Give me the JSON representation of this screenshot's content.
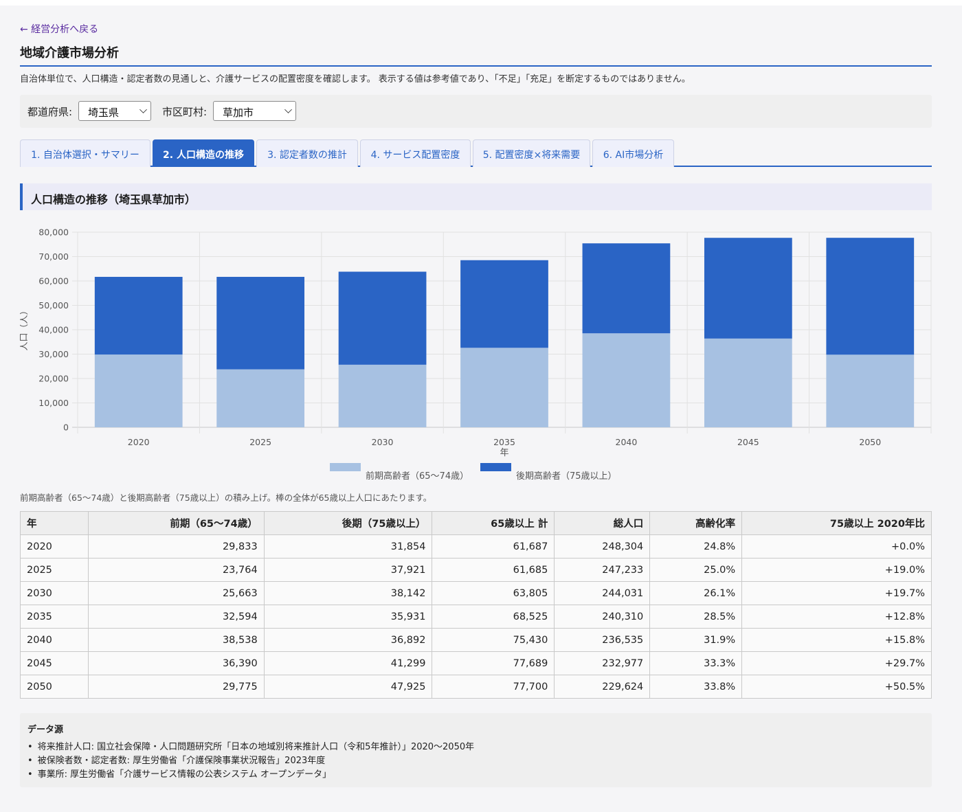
{
  "back_link": "← 経営分析へ戻る",
  "page_title": "地域介護市場分析",
  "description": "自治体単位で、人口構造・認定者数の見通しと、介護サービスの配置密度を確認します。 表示する値は参考値であり、「不足」「充足」を断定するものではありません。",
  "filters": {
    "prefecture_label": "都道府県:",
    "prefecture_value": "埼玉県",
    "city_label": "市区町村:",
    "city_value": "草加市"
  },
  "tabs": [
    {
      "label": "1. 自治体選択・サマリー",
      "active": false
    },
    {
      "label": "2. 人口構造の推移",
      "active": true
    },
    {
      "label": "3. 認定者数の推計",
      "active": false
    },
    {
      "label": "4. サービス配置密度",
      "active": false
    },
    {
      "label": "5. 配置密度×将来需要",
      "active": false
    },
    {
      "label": "6. AI市場分析",
      "active": false
    }
  ],
  "section_title": "人口構造の推移（埼玉県草加市）",
  "chart_data": {
    "type": "bar",
    "stacked": true,
    "categories": [
      "2020",
      "2025",
      "2030",
      "2035",
      "2040",
      "2045",
      "2050"
    ],
    "series": [
      {
        "name": "前期高齢者（65〜74歳）",
        "color": "#a7c1e2",
        "values": [
          29833,
          23764,
          25663,
          32594,
          38538,
          36390,
          29775
        ]
      },
      {
        "name": "後期高齢者（75歳以上）",
        "color": "#2a64c5",
        "values": [
          31854,
          37921,
          38142,
          35931,
          36892,
          41299,
          47925
        ]
      }
    ],
    "xlabel": "年",
    "ylabel": "人口（人）",
    "ylim": [
      0,
      80000
    ],
    "yticks": [
      "0",
      "10,000",
      "20,000",
      "30,000",
      "40,000",
      "50,000",
      "60,000",
      "70,000",
      "80,000"
    ],
    "grid": true,
    "legend_position": "bottom"
  },
  "chart_note": "前期高齢者（65〜74歳）と後期高齢者（75歳以上）の積み上げ。棒の全体が65歳以上人口にあたります。",
  "table": {
    "headers": [
      "年",
      "前期（65〜74歳）",
      "後期（75歳以上）",
      "65歳以上 計",
      "総人口",
      "高齢化率",
      "75歳以上 2020年比"
    ],
    "rows": [
      [
        "2020",
        "29,833",
        "31,854",
        "61,687",
        "248,304",
        "24.8%",
        "+0.0%"
      ],
      [
        "2025",
        "23,764",
        "37,921",
        "61,685",
        "247,233",
        "25.0%",
        "+19.0%"
      ],
      [
        "2030",
        "25,663",
        "38,142",
        "63,805",
        "244,031",
        "26.1%",
        "+19.7%"
      ],
      [
        "2035",
        "32,594",
        "35,931",
        "68,525",
        "240,310",
        "28.5%",
        "+12.8%"
      ],
      [
        "2040",
        "38,538",
        "36,892",
        "75,430",
        "236,535",
        "31.9%",
        "+15.8%"
      ],
      [
        "2045",
        "36,390",
        "41,299",
        "77,689",
        "232,977",
        "33.3%",
        "+29.7%"
      ],
      [
        "2050",
        "29,775",
        "47,925",
        "77,700",
        "229,624",
        "33.8%",
        "+50.5%"
      ]
    ]
  },
  "sources": {
    "title": "データ源",
    "items": [
      "将来推計人口: 国立社会保障・人口問題研究所「日本の地域別将来推計人口（令和5年推計）」2020〜2050年",
      "被保険者数・認定者数: 厚生労働省「介護保険事業状況報告」2023年度",
      "事業所: 厚生労働省「介護サービス情報の公表システム オープンデータ」"
    ]
  }
}
